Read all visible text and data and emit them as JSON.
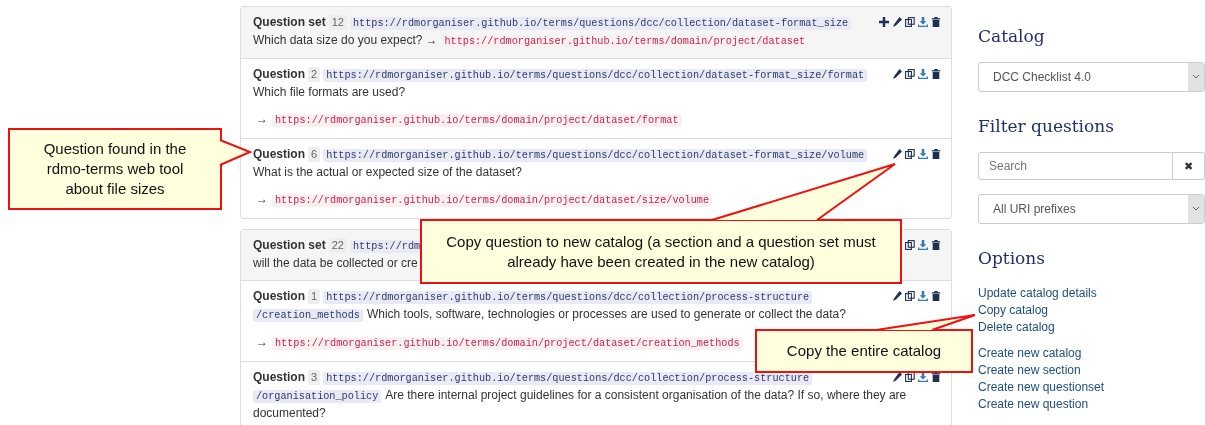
{
  "panels": [
    {
      "header": {
        "label": "Question set",
        "number": "12",
        "uri": "https://rdmorganiser.github.io/terms/questions/dcc/collection/dataset-format_size",
        "text": "Which data size do you expect?",
        "arrow": "→",
        "attribute": "https://rdmorganiser.github.io/terms/domain/project/dataset",
        "actions": [
          {
            "kind": "add"
          },
          {
            "kind": "edit"
          },
          {
            "kind": "copy"
          },
          {
            "kind": "download"
          },
          {
            "kind": "delete"
          }
        ]
      },
      "questions": [
        {
          "label": "Question",
          "number": "2",
          "uri": "https://rdmorganiser.github.io/terms/questions/dcc/collection/dataset-format_size/format",
          "text": "Which file formats are used?",
          "arrow": "→",
          "attribute": "https://rdmorganiser.github.io/terms/domain/project/dataset/format",
          "actions": [
            {
              "kind": "edit"
            },
            {
              "kind": "copy"
            },
            {
              "kind": "download"
            },
            {
              "kind": "delete"
            }
          ]
        },
        {
          "label": "Question",
          "number": "6",
          "uri": "https://rdmorganiser.github.io/terms/questions/dcc/collection/dataset-format_size/volume",
          "text": "What is the actual or expected size of the dataset?",
          "arrow": "→",
          "attribute": "https://rdmorganiser.github.io/terms/domain/project/dataset/size/volume",
          "actions": [
            {
              "kind": "edit"
            },
            {
              "kind": "copy"
            },
            {
              "kind": "download"
            },
            {
              "kind": "delete"
            }
          ]
        }
      ]
    },
    {
      "header": {
        "label": "Question set",
        "number": "22",
        "uri": "https://rdm",
        "text": "will the data be collected or cre",
        "actions": [
          {
            "kind": "copy"
          },
          {
            "kind": "download"
          },
          {
            "kind": "delete"
          }
        ]
      },
      "questions": [
        {
          "label": "Question",
          "number": "1",
          "uri": "https://rdmorganiser.github.io/terms/questions/dcc/collection/process-structure",
          "uri_continued": "/creation_methods",
          "text": "Which tools, software, technologies or processes are used to generate or collect the data?",
          "arrow": "→",
          "attribute": "https://rdmorganiser.github.io/terms/domain/project/dataset/creation_methods",
          "actions": [
            {
              "kind": "edit"
            },
            {
              "kind": "copy"
            },
            {
              "kind": "download"
            },
            {
              "kind": "delete"
            }
          ]
        },
        {
          "label": "Question",
          "number": "3",
          "uri": "https://rdmorganiser.github.io/terms/questions/dcc/collection/process-structure",
          "uri_continued": "/organisation_policy",
          "text": "Are there internal project guidelines for a consistent organisation of the data? If so, where they are",
          "text_continued": "documented?",
          "actions": [
            {
              "kind": "edit"
            },
            {
              "kind": "copy"
            },
            {
              "kind": "download"
            },
            {
              "kind": "delete"
            }
          ]
        }
      ]
    }
  ],
  "sidebar": {
    "catalog_heading": "Catalog",
    "catalog_select": "DCC Checklist 4.0",
    "filter_heading": "Filter questions",
    "search": {
      "placeholder": "Search",
      "clear": "✖"
    },
    "prefix_select": "All URI prefixes",
    "options_heading": "Options",
    "option_groups": [
      [
        "Update catalog details",
        "Copy catalog",
        "Delete catalog"
      ],
      [
        "Create new catalog",
        "Create new section",
        "Create new questionset",
        "Create new question"
      ]
    ]
  },
  "callouts": [
    {
      "text": "Question found in the rdmo-terms web tool about file sizes"
    },
    {
      "text": "Copy question to new catalog (a section and a question set must already have been created in the new catalog)"
    },
    {
      "text": "Copy the entire catalog"
    }
  ]
}
